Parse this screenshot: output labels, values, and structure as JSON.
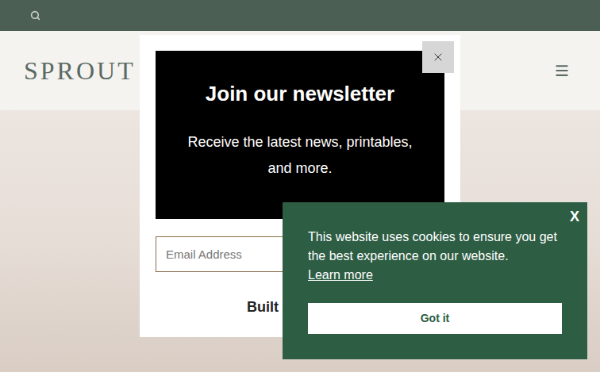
{
  "top_bar": {
    "search": true
  },
  "header": {
    "logo": "SPROUT",
    "menu": true
  },
  "newsletter_modal": {
    "title": "Join our newsletter",
    "description": "Receive the latest news, printables, and more.",
    "email": {
      "placeholder": "Email Address"
    },
    "footer": "Built w"
  },
  "cookie_banner": {
    "close": "X",
    "message": "This website uses cookies to ensure you get the best experience on our website.",
    "link": "Learn more",
    "button": "Got it"
  }
}
